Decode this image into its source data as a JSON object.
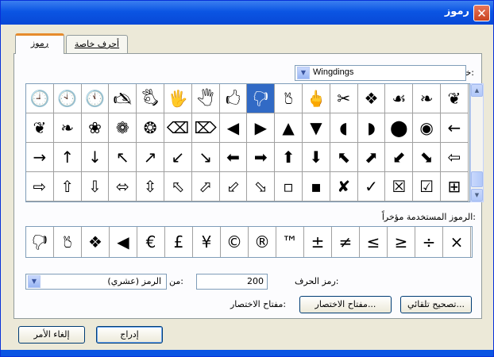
{
  "window": {
    "title": "رموز",
    "close_label": "✕"
  },
  "tabs": [
    {
      "label": "رموز",
      "active": true
    },
    {
      "label": "أحرف خاصة",
      "active": false
    }
  ],
  "font": {
    "label": "خط:",
    "value": "Wingdings"
  },
  "symbols": {
    "rows": [
      [
        "🕘",
        "🕙",
        "🕚",
        "🖎",
        "🖏",
        "🖐",
        "🖑",
        "🖒",
        "🖓",
        "🖔",
        "🖕",
        "✂",
        "❖",
        "☙",
        "❧",
        "❦"
      ],
      [
        "❦",
        "❧",
        "❀",
        "❁",
        "❂",
        "⌫",
        "⌦",
        "◀",
        "▶",
        "▲",
        "▼",
        "◖",
        "◗",
        "⬤",
        "◉",
        "←"
      ],
      [
        "→",
        "↑",
        "↓",
        "↖",
        "↗",
        "↙",
        "↘",
        "⬅",
        "➡",
        "⬆",
        "⬇",
        "⬉",
        "⬈",
        "⬋",
        "⬊",
        "⇦"
      ],
      [
        "⇨",
        "⇧",
        "⇩",
        "⬄",
        "⇳",
        "⬁",
        "⬀",
        "⬃",
        "⬂",
        "▫",
        "▪",
        "✘",
        "✓",
        "☒",
        "☑",
        "⊞"
      ]
    ],
    "selected": {
      "row": 0,
      "col": 8
    }
  },
  "recent": {
    "label": "الرموز المستخدمة مؤخراً:",
    "items": [
      "🖓",
      "🖔",
      "❖",
      "◀",
      "€",
      "£",
      "¥",
      "©",
      "®",
      "™",
      "±",
      "≠",
      "≤",
      "≥",
      "÷",
      "×"
    ]
  },
  "char_code": {
    "label": "رمز الحرف:",
    "value": "200"
  },
  "from": {
    "label": "من:",
    "value": "الرمز (عشري)"
  },
  "buttons": {
    "autocorrect": "تصحيح تلقائي...",
    "shortcut_key": "مفتاح الاختصار...",
    "shortcut_label": "مفتاح الاختصار:",
    "insert": "إدراج",
    "cancel": "إلغاء الأمر"
  }
}
